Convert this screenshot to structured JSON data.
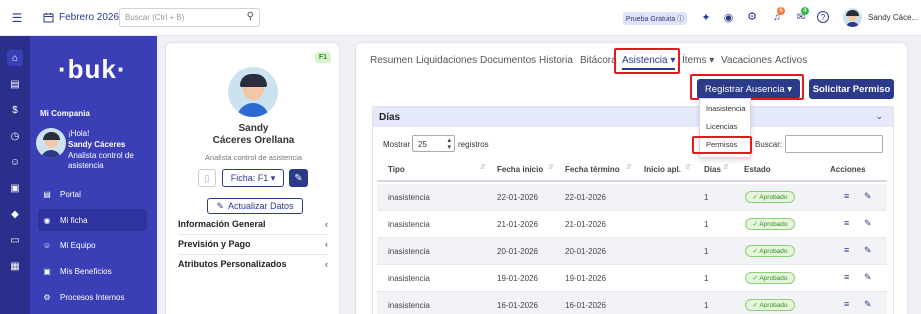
{
  "topbar": {
    "month": "Febrero 2026",
    "search_placeholder": "Buscar (Ctrl + B)",
    "trial": "Prueba Gratuita ⓘ",
    "notif_count": "6",
    "msg_count": "4",
    "user": "Sandy Cáce..."
  },
  "sidebar": {
    "logo": "·buk·",
    "company": "Mi Compania",
    "greeting": "¡Hola!",
    "name": "Sandy Cáceres",
    "role_line1": "Analista control de",
    "role_line2": "asistencia",
    "items": [
      {
        "label": "Portal"
      },
      {
        "label": "Mi ficha"
      },
      {
        "label": "Mi Equipo"
      },
      {
        "label": "Mis Beneficios"
      },
      {
        "label": "Procesos Internos"
      }
    ]
  },
  "profile": {
    "badge": "F1",
    "first": "Sandy",
    "last": "Cáceres Orellana",
    "role": "Analista control de asistencia",
    "ficha": "Ficha: F1 ▾",
    "update": "Actualizar Datos",
    "sections": [
      "Información General",
      "Previsión y Pago",
      "Atributos Personalizados"
    ]
  },
  "tabs": [
    "Resumen",
    "Liquidaciones",
    "Documentos",
    "Historia",
    "Bitácora",
    "Asistencia ▾",
    "Ítems ▾",
    "Vacaciones",
    "Activos"
  ],
  "actions": {
    "register": "Registrar Ausencia ▾",
    "permit": "Solicitar Permiso"
  },
  "dropdown": [
    "Inasistencia",
    "Licencias",
    "Permisos"
  ],
  "dias": {
    "title": "Días",
    "show": "Mostrar",
    "per_page": "25",
    "records": "registros",
    "search": "Buscar:"
  },
  "table": {
    "headers": [
      "Tipo",
      "Fecha inicio",
      "Fecha término",
      "Inicio apl.",
      "Días",
      "Estado",
      "Acciones"
    ],
    "rows": [
      [
        "inasistencia",
        "22-01-2026",
        "22-01-2026",
        "",
        "1",
        "✓ Aprobado"
      ],
      [
        "inasistencia",
        "21-01-2026",
        "21-01-2026",
        "",
        "1",
        "✓ Aprobado"
      ],
      [
        "inasistencia",
        "20-01-2026",
        "20-01-2026",
        "",
        "1",
        "✓ Aprobado"
      ],
      [
        "inasistencia",
        "19-01-2026",
        "19-01-2026",
        "",
        "1",
        "✓ Aprobado"
      ],
      [
        "inasistencia",
        "16-01-2026",
        "16-01-2026",
        "",
        "1",
        "✓ Aprobado"
      ]
    ]
  }
}
